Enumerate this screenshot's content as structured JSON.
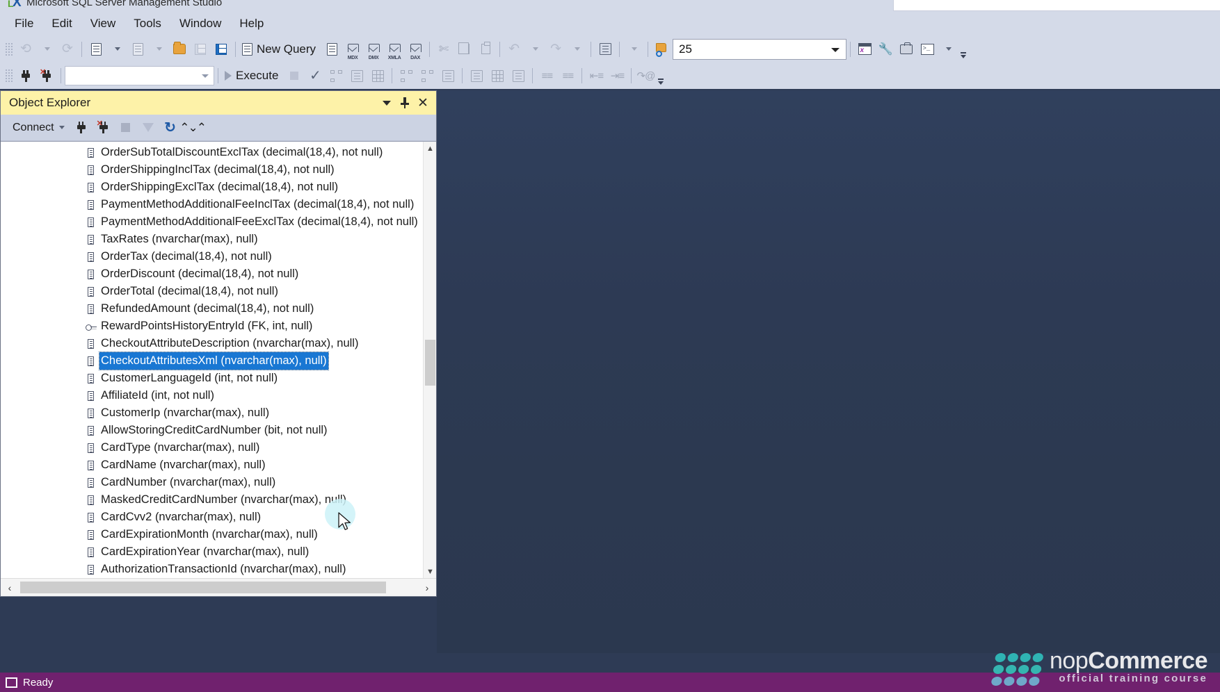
{
  "window": {
    "title": "Microsoft SQL Server Management Studio",
    "logo_letters": [
      "L",
      "X"
    ]
  },
  "menubar": {
    "items": [
      {
        "label": "File",
        "name": "menu-file"
      },
      {
        "label": "Edit",
        "name": "menu-edit"
      },
      {
        "label": "View",
        "name": "menu-view"
      },
      {
        "label": "Tools",
        "name": "menu-tools"
      },
      {
        "label": "Window",
        "name": "menu-window"
      },
      {
        "label": "Help",
        "name": "menu-help"
      }
    ]
  },
  "toolbar": {
    "new_query_label": "New Query",
    "query_types": [
      "MDX",
      "DMX",
      "XMLA",
      "DAX"
    ],
    "search_value": "25",
    "icons": [
      "navigate-back-icon",
      "navigate-forward-icon",
      "new-query-icon",
      "new-project-icon",
      "open-file-icon",
      "save-icon",
      "save-all-icon",
      "new-query-doc-icon",
      "cut-icon",
      "copy-icon",
      "paste-icon",
      "undo-icon",
      "redo-icon",
      "toggle-icon",
      "find-icon"
    ]
  },
  "toolbar2": {
    "database_combo_value": "",
    "execute_label": "Execute",
    "icons": [
      "connect-icon",
      "disconnect-icon",
      "execute-icon",
      "stop-icon",
      "parse-icon",
      "display-estimated-plan-icon",
      "query-options-icon",
      "results-to-grid-icon",
      "include-actual-plan-icon",
      "include-client-statistics-icon",
      "results-to-text-icon",
      "results-to-file-icon",
      "comment-icon",
      "uncomment-icon",
      "decrease-indent-icon",
      "increase-indent-icon",
      "specify-values-icon"
    ]
  },
  "object_explorer": {
    "title": "Object Explorer",
    "title_buttons": [
      {
        "name": "oe-dropdown-button",
        "glyph": "chevron-down-icon"
      },
      {
        "name": "oe-pin-button",
        "glyph": "pin-icon"
      },
      {
        "name": "oe-close-button",
        "glyph": "close-icon"
      }
    ],
    "connect_label": "Connect",
    "toolbar_buttons": [
      {
        "name": "oe-connect-object-icon",
        "title": "Connect"
      },
      {
        "name": "oe-disconnect-icon",
        "title": "Disconnect"
      },
      {
        "name": "oe-stop-icon",
        "title": "Stop"
      },
      {
        "name": "oe-filter-icon",
        "title": "Filter"
      },
      {
        "name": "oe-refresh-icon",
        "title": "Refresh"
      },
      {
        "name": "oe-activity-monitor-icon",
        "title": "Activity Monitor"
      }
    ],
    "selected_index": 12,
    "tree_items": [
      {
        "icon": "column-icon",
        "label": "OrderSubTotalDiscountExclTax (decimal(18,4), not null)"
      },
      {
        "icon": "column-icon",
        "label": "OrderShippingInclTax (decimal(18,4), not null)"
      },
      {
        "icon": "column-icon",
        "label": "OrderShippingExclTax (decimal(18,4), not null)"
      },
      {
        "icon": "column-icon",
        "label": "PaymentMethodAdditionalFeeInclTax (decimal(18,4), not null)"
      },
      {
        "icon": "column-icon",
        "label": "PaymentMethodAdditionalFeeExclTax (decimal(18,4), not null)"
      },
      {
        "icon": "column-icon",
        "label": "TaxRates (nvarchar(max), null)"
      },
      {
        "icon": "column-icon",
        "label": "OrderTax (decimal(18,4), not null)"
      },
      {
        "icon": "column-icon",
        "label": "OrderDiscount (decimal(18,4), not null)"
      },
      {
        "icon": "column-icon",
        "label": "OrderTotal (decimal(18,4), not null)"
      },
      {
        "icon": "column-icon",
        "label": "RefundedAmount (decimal(18,4), not null)"
      },
      {
        "icon": "foreign-key-icon",
        "label": "RewardPointsHistoryEntryId (FK, int, null)"
      },
      {
        "icon": "column-icon",
        "label": "CheckoutAttributeDescription (nvarchar(max), null)"
      },
      {
        "icon": "column-icon",
        "label": "CheckoutAttributesXml (nvarchar(max), null)"
      },
      {
        "icon": "column-icon",
        "label": "CustomerLanguageId (int, not null)"
      },
      {
        "icon": "column-icon",
        "label": "AffiliateId (int, not null)"
      },
      {
        "icon": "column-icon",
        "label": "CustomerIp (nvarchar(max), null)"
      },
      {
        "icon": "column-icon",
        "label": "AllowStoringCreditCardNumber (bit, not null)"
      },
      {
        "icon": "column-icon",
        "label": "CardType (nvarchar(max), null)"
      },
      {
        "icon": "column-icon",
        "label": "CardName (nvarchar(max), null)"
      },
      {
        "icon": "column-icon",
        "label": "CardNumber (nvarchar(max), null)"
      },
      {
        "icon": "column-icon",
        "label": "MaskedCreditCardNumber (nvarchar(max), null)"
      },
      {
        "icon": "column-icon",
        "label": "CardCvv2 (nvarchar(max), null)"
      },
      {
        "icon": "column-icon",
        "label": "CardExpirationMonth (nvarchar(max), null)"
      },
      {
        "icon": "column-icon",
        "label": "CardExpirationYear (nvarchar(max), null)"
      },
      {
        "icon": "column-icon",
        "label": "AuthorizationTransactionId (nvarchar(max), null)"
      }
    ],
    "scrollbar": {
      "up_glyph": "▲",
      "down_glyph": "▼",
      "left_glyph": "‹",
      "right_glyph": "›"
    }
  },
  "statusbar": {
    "text": "Ready"
  },
  "watermark": {
    "brand_light": "nop",
    "brand_bold": "Commerce",
    "subtitle": "official training course",
    "dot_colors_row1": "#2fb3b3",
    "dot_colors_row2": "#35b5b0",
    "dot_colors_row3": "#6fa8c9"
  },
  "colors": {
    "chrome": "#d4dae8",
    "panel_title_active": "#fdf2a8",
    "selection_blue": "#1977d3",
    "workspace_bg": "#2e3b55",
    "statusbar_purple": "#70216e",
    "accent_teal": "#2fb3b3"
  }
}
